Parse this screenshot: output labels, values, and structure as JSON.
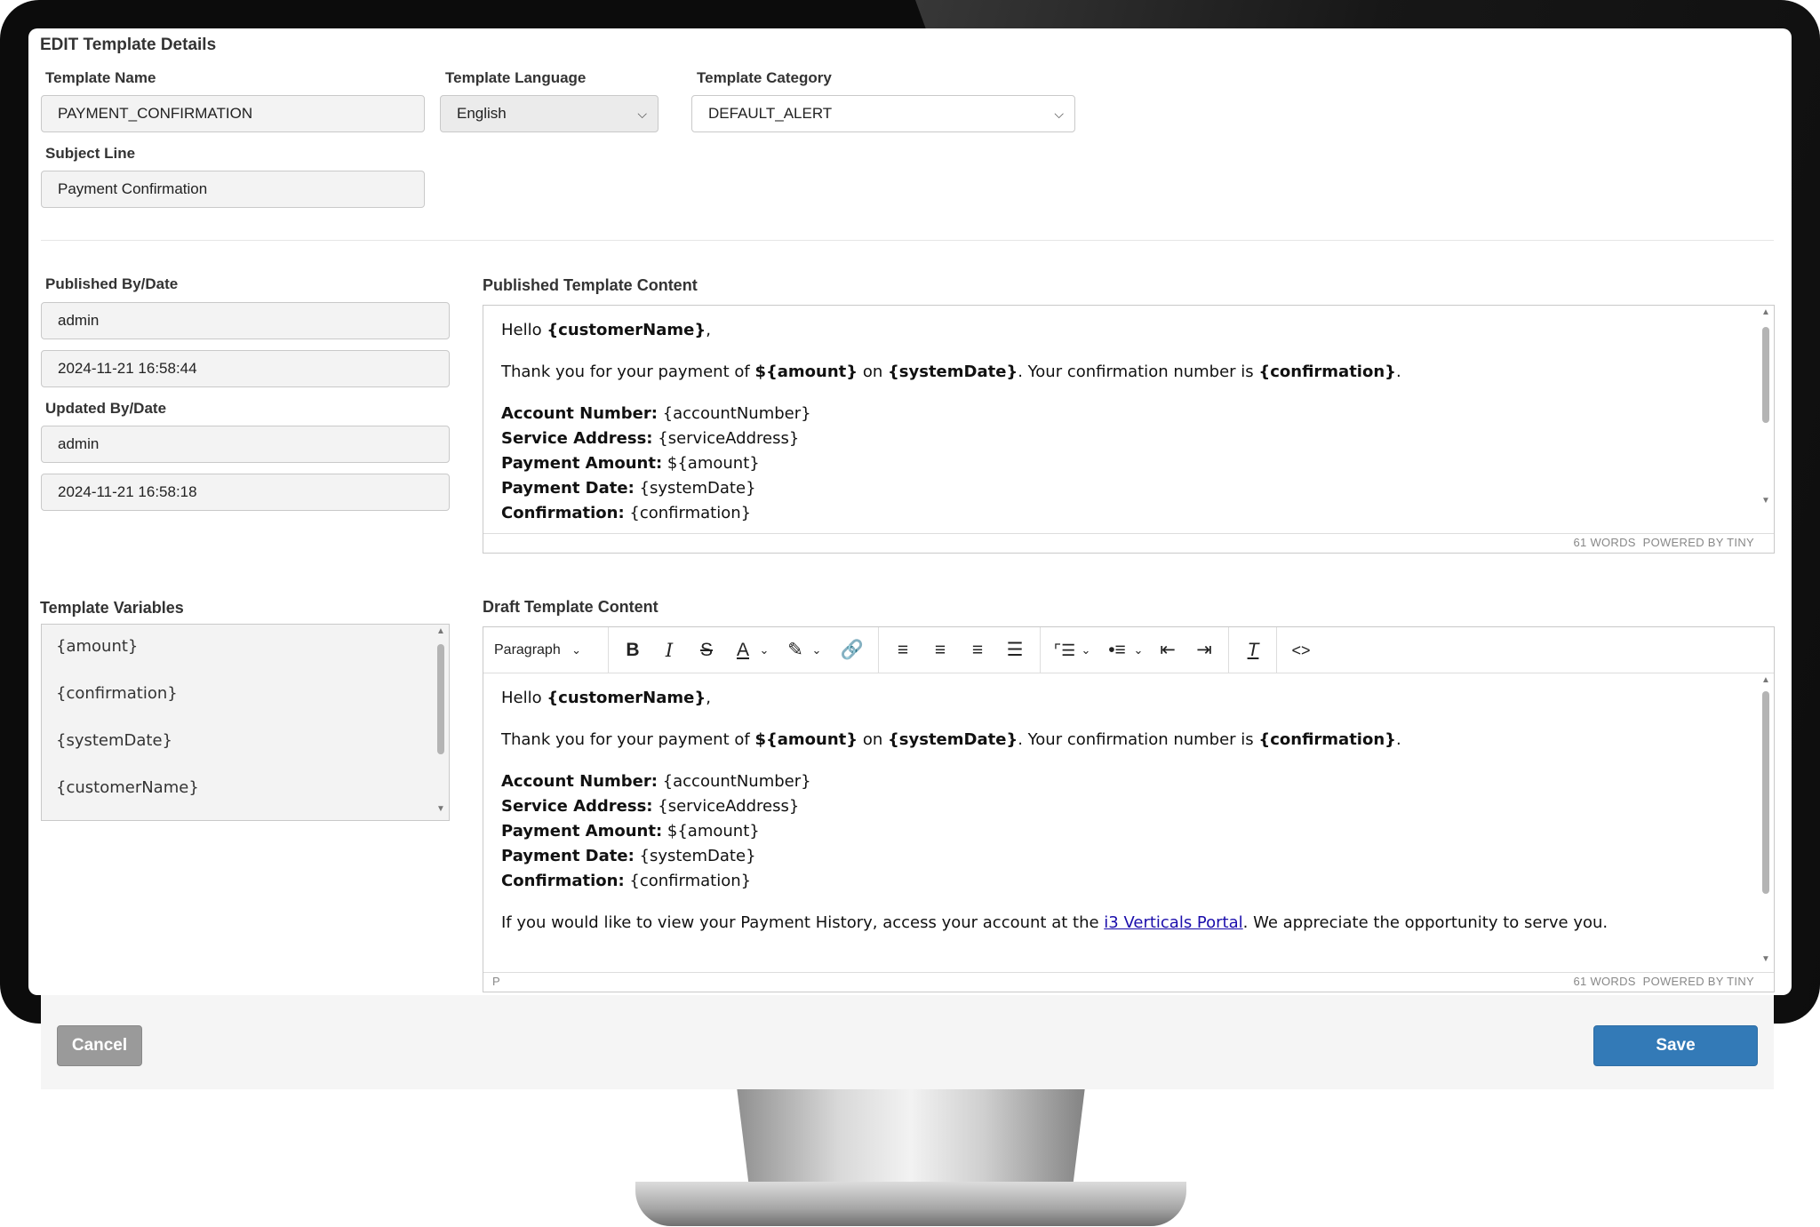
{
  "page_title": "EDIT Template Details",
  "fields": {
    "template_name_label": "Template Name",
    "template_name_value": "PAYMENT_CONFIRMATION",
    "template_language_label": "Template Language",
    "template_language_value": "English",
    "template_category_label": "Template Category",
    "template_category_value": "DEFAULT_ALERT",
    "subject_line_label": "Subject Line",
    "subject_line_value": "Payment Confirmation"
  },
  "published": {
    "by_date_label": "Published By/Date",
    "by": "admin",
    "date": "2024-11-21 16:58:44",
    "content_label": "Published Template Content",
    "word_count": "61 WORDS",
    "powered_by": "POWERED BY TINY"
  },
  "updated": {
    "by_date_label": "Updated By/Date",
    "by": "admin",
    "date": "2024-11-21 16:58:18"
  },
  "variables": {
    "label": "Template Variables",
    "items": [
      "{amount}",
      "{confirmation}",
      "{systemDate}",
      "{customerName}"
    ]
  },
  "template": {
    "hello": "Hello ",
    "customer_var": "{customerName}",
    "comma": ",",
    "thank_you": "Thank you for your payment of ",
    "amount_var": "${amount}",
    "on": " on ",
    "date_var": "{systemDate}",
    "confirm_text": ".  Your confirmation number is ",
    "confirm_var": "{confirmation}",
    "period": ".",
    "account_label": "Account Number:",
    "account_value": " {accountNumber}",
    "service_label": "Service Address:",
    "service_value": " {serviceAddress}",
    "payment_amount_label": "Payment Amount:",
    "payment_amount_value": " ${amount}",
    "payment_date_label": "Payment Date:",
    "payment_date_value": " {systemDate}",
    "confirmation_label": "Confirmation:",
    "confirmation_value": " {confirmation}",
    "history_text": "If you would like to view your Payment History, access your account at the ",
    "portal_link": "i3 Verticals Portal",
    "history_end": ".  We appreciate the opportunity to serve you."
  },
  "draft": {
    "content_label": "Draft Template Content",
    "block_format": "Paragraph",
    "element_path": "P",
    "word_count": "61 WORDS",
    "powered_by": "POWERED BY TINY"
  },
  "buttons": {
    "cancel": "Cancel",
    "save": "Save"
  },
  "colors": {
    "save_button": "#337ab7",
    "cancel_button": "#9a9a9a",
    "link": "#1a0dab"
  }
}
